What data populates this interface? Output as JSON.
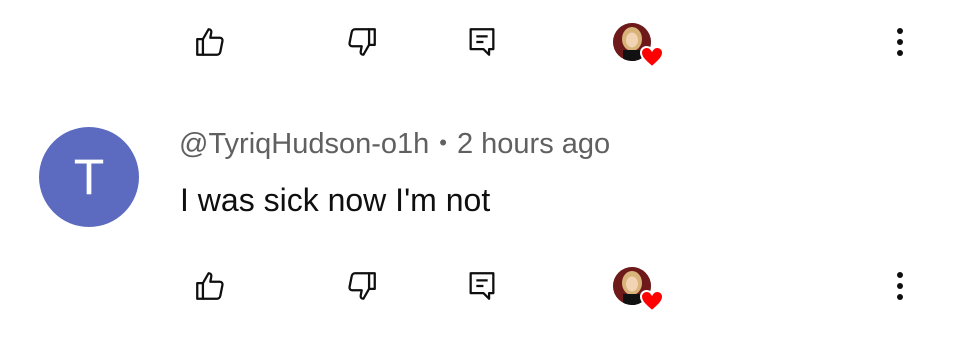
{
  "comment": {
    "author_initial": "T",
    "author_handle": "@TyriqHudson-o1h",
    "separator": "•",
    "time_ago": "2 hours ago",
    "text": "I was sick now I'm not",
    "avatar_color": "#5c6bc0"
  },
  "actions": {
    "like_icon": "thumbs-up-icon",
    "dislike_icon": "thumbs-down-icon",
    "reply_icon": "reply-comment-icon",
    "creator_heart_icon": "creator-heart-icon",
    "more_icon": "more-vertical-icon",
    "heart_color": "#ff0000"
  }
}
